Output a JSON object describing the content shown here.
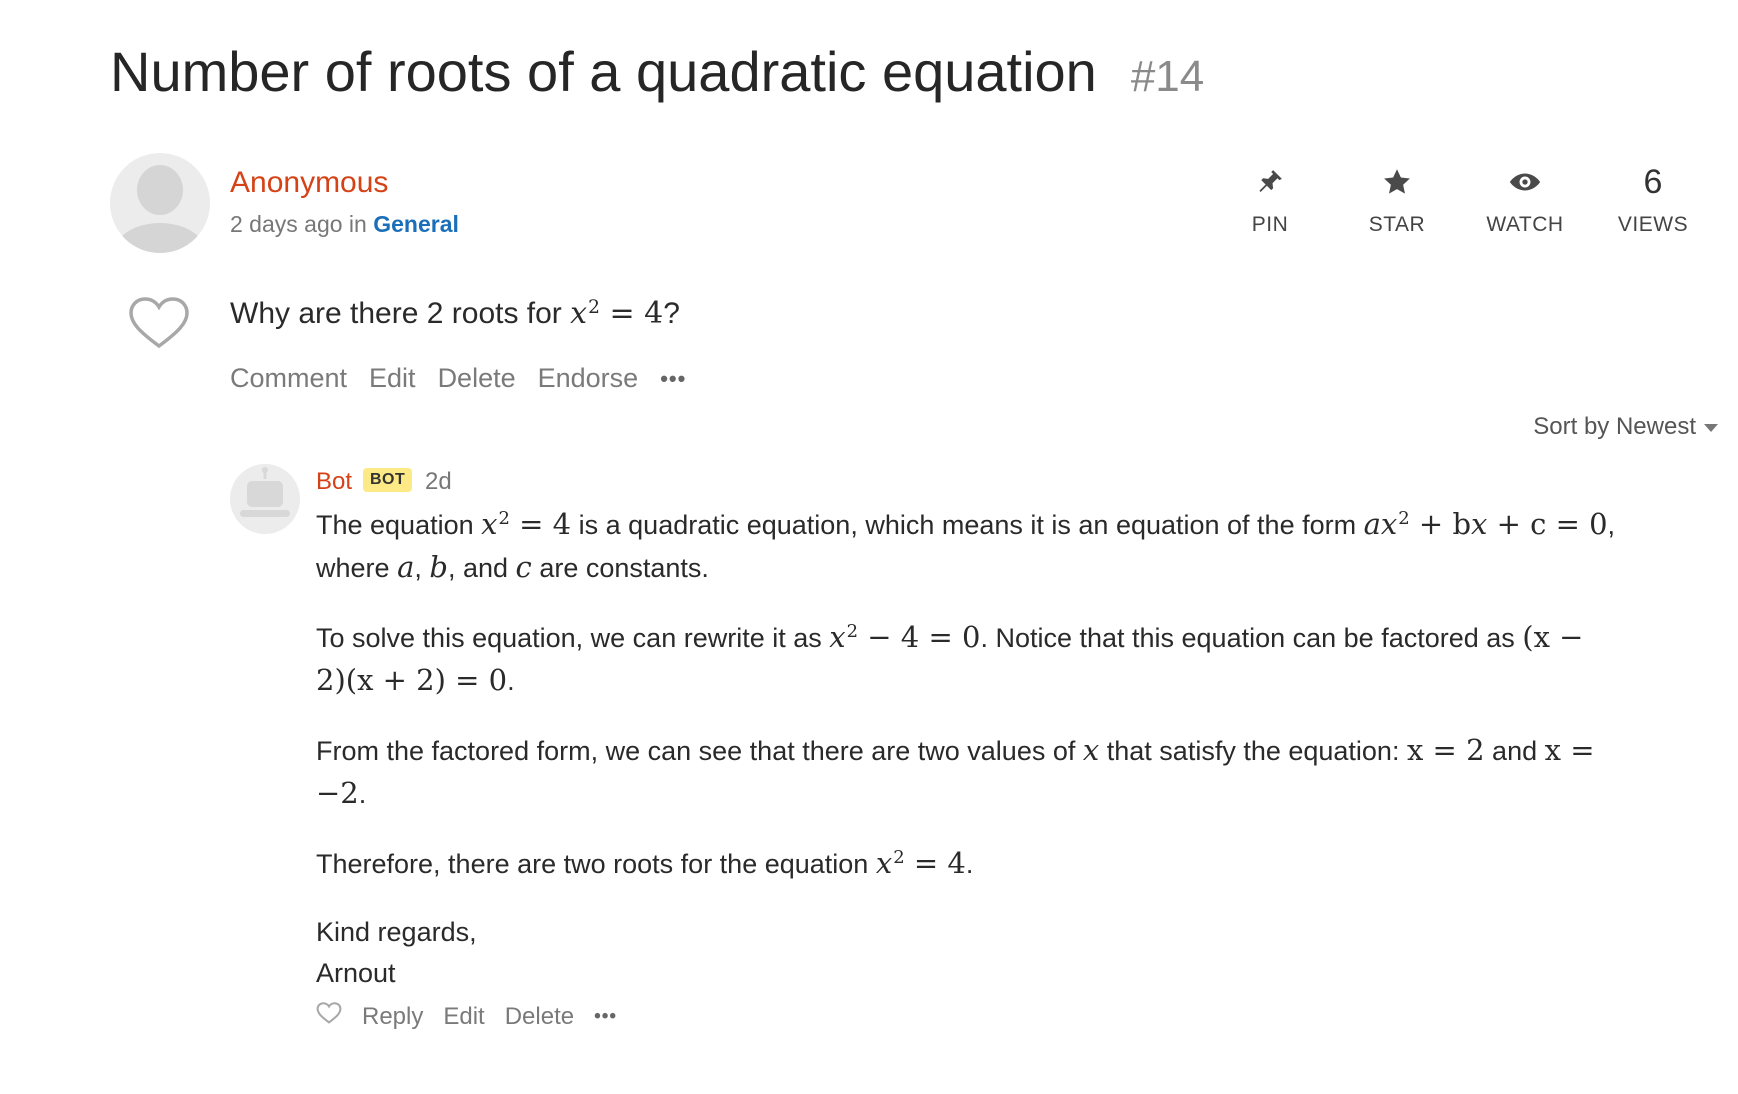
{
  "thread": {
    "title": "Number of roots of a quadratic equation",
    "number": "#14",
    "author": "Anonymous",
    "time_text": "2 days ago",
    "in_text": "in",
    "category": "General",
    "question_text": "Why are there 2 roots for",
    "question_math": {
      "base": "x",
      "exp": "2",
      "rhs": " = 4"
    },
    "question_end": "?"
  },
  "stats": {
    "pin_label": "PIN",
    "star_label": "STAR",
    "watch_label": "WATCH",
    "views_count": "6",
    "views_label": "VIEWS"
  },
  "question_actions": [
    "Comment",
    "Edit",
    "Delete",
    "Endorse"
  ],
  "more_glyph": "•••",
  "sort": {
    "label": "Sort by Newest"
  },
  "reply": {
    "author": "Bot",
    "badge": "BOT",
    "time": "2d",
    "p1": {
      "t1": "The equation",
      "t2": "is a quadratic equation, which means it is an equation of the form",
      "t3": ",",
      "t4": "where",
      "t5": ",",
      "t6": ", and",
      "t7": "are constants.",
      "m_form_a": "a",
      "m_form_b": "+ b",
      "m_form_c": "+ c = 0",
      "var_a": "a",
      "var_b": "b",
      "var_c": "c"
    },
    "p2": {
      "t1": "To solve this equation, we can rewrite it as",
      "m1": "− 4 = 0",
      "t2": ". Notice that this equation can be factored as",
      "m2a": "(x −",
      "m2b": "2)(x + 2) = 0",
      "t3": "."
    },
    "p3": {
      "t1": "From the factored form, we can see that there are two values of",
      "t2": "that satisfy the equation:",
      "m1": "x = 2",
      "t3": "and",
      "m2a": "x =",
      "m2b": "−2",
      "t4": "."
    },
    "p4": {
      "t1": "Therefore, there are two roots for the equation",
      "m1": " = 4",
      "t2": "."
    },
    "closing": "Kind regards,",
    "signature": "Arnout"
  },
  "reply_actions": [
    "Reply",
    "Edit",
    "Delete"
  ],
  "math_common": {
    "x": "x",
    "two": "2",
    "eq4": " = 4"
  }
}
